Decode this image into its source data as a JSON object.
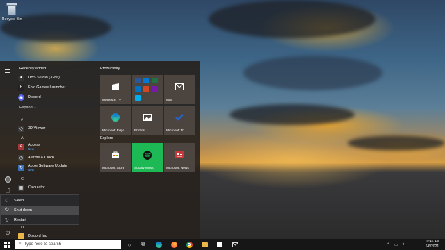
{
  "desktop": {
    "recycle_bin_label": "Recycle Bin"
  },
  "start_menu": {
    "recently_added_title": "Recently added",
    "recent_apps": [
      {
        "name": "OBS Studio (32bit)",
        "icon": "obs-icon",
        "color": "#3a3a3a"
      },
      {
        "name": "Epic Games Launcher",
        "icon": "epic-icon",
        "color": "#222222"
      },
      {
        "name": "Discord",
        "icon": "discord-icon",
        "color": "#5865f2"
      }
    ],
    "expand_label": "Expand",
    "sections": [
      {
        "letter": "#",
        "apps": [
          {
            "name": "3D Viewer",
            "sub": "",
            "icon": "cube-icon",
            "color": "#3a3a3a"
          }
        ]
      },
      {
        "letter": "A",
        "apps": [
          {
            "name": "Access",
            "sub": "New",
            "icon": "access-icon",
            "color": "#a4373a"
          },
          {
            "name": "Alarms & Clock",
            "sub": "",
            "icon": "alarm-icon",
            "color": "#3a3a3a"
          },
          {
            "name": "Apple Software Update",
            "sub": "New",
            "icon": "apple-update-icon",
            "color": "#3a6fb5"
          }
        ]
      },
      {
        "letter": "C",
        "apps": [
          {
            "name": "Calculator",
            "sub": "",
            "icon": "calculator-icon",
            "color": "#3a3a3a"
          }
        ]
      },
      {
        "letter": "D",
        "apps": [
          {
            "name": "Discord Inc",
            "sub": "",
            "icon": "folder-icon",
            "color": "#e8b64a"
          }
        ]
      }
    ],
    "power_menu": {
      "sleep": "Sleep",
      "shut_down": "Shut down",
      "restart": "Restart"
    },
    "tile_groups": {
      "productivity_title": "Productivity",
      "explore_title": "Explore"
    },
    "tiles": {
      "movies": "Movies & TV",
      "office": "",
      "mail": "Mail",
      "edge": "Microsoft Edge",
      "photos": "Photos",
      "todo": "Microsoft To...",
      "store": "Microsoft Store",
      "spotify": "Spotify Music",
      "news": "Microsoft News"
    }
  },
  "taskbar": {
    "search_placeholder": "Type here to search",
    "time": "10:46 AM",
    "date": "6/6/2021"
  },
  "colors": {
    "spotify_green": "#1db954",
    "edge_blue": "#0c7bd6",
    "todo_blue": "#2564cf",
    "news_red": "#c8373a"
  }
}
